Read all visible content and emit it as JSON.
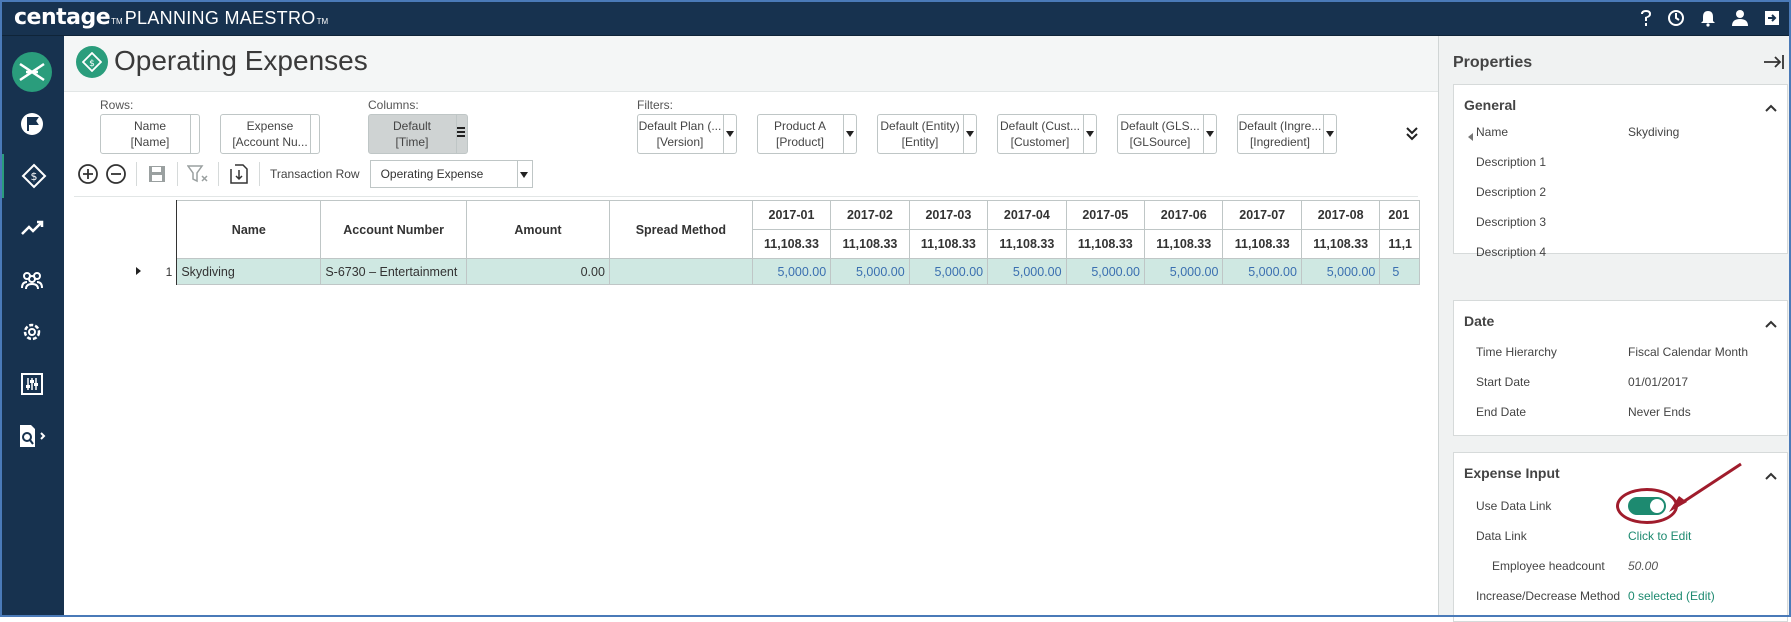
{
  "brand": {
    "name": "centage",
    "tm1": "TM",
    "product": "PLANNING MAESTRO",
    "tm2": "TM"
  },
  "topbar_icons": [
    "help-icon",
    "history-icon",
    "notifications-icon",
    "user-icon",
    "logout-icon"
  ],
  "nav_items": [
    "logo-icon",
    "flag-icon",
    "expenses-icon",
    "trend-icon",
    "people-icon",
    "settings-icon",
    "sliders-icon",
    "report-search-icon"
  ],
  "page": {
    "title": "Operating Expenses"
  },
  "rows_label": "Rows:",
  "columns_label": "Columns:",
  "filters_label": "Filters:",
  "row_pills": [
    {
      "line1": "Name",
      "line2": "[Name]"
    },
    {
      "line1": "Expense",
      "line2": "[Account Nu..."
    }
  ],
  "column_pills": [
    {
      "line1": "Default",
      "line2": "[Time]"
    }
  ],
  "filter_pills": [
    {
      "line1": "Default Plan (...",
      "line2": "[Version]"
    },
    {
      "line1": "Product A",
      "line2": "[Product]"
    },
    {
      "line1": "Default (Entity)",
      "line2": "[Entity]"
    },
    {
      "line1": "Default (Cust...",
      "line2": "[Customer]"
    },
    {
      "line1": "Default (GLS...",
      "line2": "[GLSource]"
    },
    {
      "line1": "Default (Ingre...",
      "line2": "[Ingredient]"
    }
  ],
  "toolbar": {
    "transaction_label": "Transaction Row",
    "transaction_value": "Operating Expense"
  },
  "grid": {
    "headers": [
      "Name",
      "Account Number",
      "Amount",
      "Spread Method"
    ],
    "months": [
      "2017-01",
      "2017-02",
      "2017-03",
      "2017-04",
      "2017-05",
      "2017-06",
      "2017-07",
      "2017-08",
      "201"
    ],
    "month_totals": [
      "11,108.33",
      "11,108.33",
      "11,108.33",
      "11,108.33",
      "11,108.33",
      "11,108.33",
      "11,108.33",
      "11,108.33",
      "11,1"
    ],
    "rows": [
      {
        "num": "1",
        "name": "Skydiving",
        "account": "S-6730 – Entertainment",
        "amount": "0.00",
        "spread": "",
        "values": [
          "5,000.00",
          "5,000.00",
          "5,000.00",
          "5,000.00",
          "5,000.00",
          "5,000.00",
          "5,000.00",
          "5,000.00",
          "5"
        ]
      }
    ]
  },
  "properties": {
    "title": "Properties",
    "general": {
      "title": "General",
      "rows": [
        {
          "label": "Name",
          "value": "Skydiving"
        },
        {
          "label": "Description 1",
          "value": ""
        },
        {
          "label": "Description 2",
          "value": ""
        },
        {
          "label": "Description 3",
          "value": ""
        },
        {
          "label": "Description 4",
          "value": ""
        }
      ]
    },
    "date": {
      "title": "Date",
      "rows": [
        {
          "label": "Time Hierarchy",
          "value": "Fiscal Calendar Month"
        },
        {
          "label": "Start Date",
          "value": "01/01/2017"
        },
        {
          "label": "End Date",
          "value": "Never Ends"
        }
      ]
    },
    "expense_input": {
      "title": "Expense Input",
      "use_data_link_label": "Use Data Link",
      "use_data_link_on": true,
      "data_link_label": "Data Link",
      "data_link_value": "Click to Edit",
      "employee_label": "Employee headcount",
      "employee_value": "50.00",
      "method_label": "Increase/Decrease Method",
      "method_value": "0 selected (Edit)"
    }
  },
  "colors": {
    "navy": "#17324f",
    "teal": "#2a9d7c",
    "row_highlight": "#cfe8e2",
    "annotation": "#a01c2c"
  }
}
